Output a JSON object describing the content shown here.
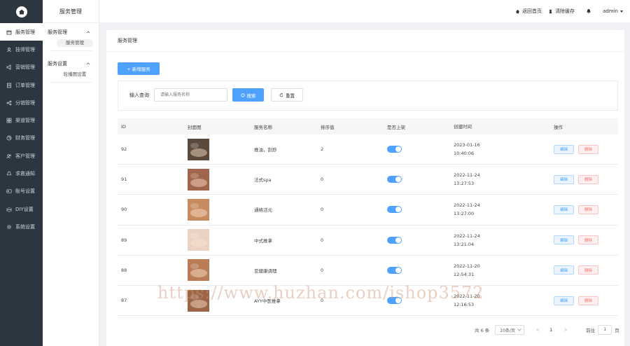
{
  "sidebar": {
    "items": [
      {
        "label": "服务管理",
        "icon": "calendar-icon",
        "active": true
      },
      {
        "label": "技师管理",
        "icon": "user-icon"
      },
      {
        "label": "营销管理",
        "icon": "megaphone-icon"
      },
      {
        "label": "订单管理",
        "icon": "clipboard-icon"
      },
      {
        "label": "分销管理",
        "icon": "share-icon"
      },
      {
        "label": "渠道管理",
        "icon": "grid-icon"
      },
      {
        "label": "财务管理",
        "icon": "pie-chart-icon"
      },
      {
        "label": "客户管理",
        "icon": "user-group-icon"
      },
      {
        "label": "求救通知",
        "icon": "bell-icon"
      },
      {
        "label": "账号设置",
        "icon": "id-card-icon"
      },
      {
        "label": "DIY设置",
        "icon": "diy-icon"
      },
      {
        "label": "系统设置",
        "icon": "gear-icon"
      }
    ]
  },
  "submenu": {
    "title": "服务管理",
    "groups": [
      {
        "label": "服务管理",
        "items": [
          "服务管理"
        ]
      },
      {
        "label": "服务设置",
        "items": [
          "轮播图设置"
        ]
      }
    ]
  },
  "topbar": {
    "home_label": "返回首页",
    "clear_cache_label": "清除缓存",
    "user_label": "admin"
  },
  "main": {
    "breadcrumb": "服务管理",
    "add_button": "+ 新增服务",
    "search": {
      "label": "输入查询",
      "placeholder": "请输入服务名称",
      "search_button": "搜索",
      "reset_button": "重置"
    },
    "table": {
      "headers": [
        "ID",
        "封面图",
        "服务名称",
        "排序值",
        "是否上架",
        "创建时间",
        "操作"
      ],
      "rows": [
        {
          "id": "92",
          "name": "推油，刮痧",
          "sort": "2",
          "on_shelf": true,
          "date": "2023-01-16",
          "time": "10:40:06",
          "cover_color": "#5b4a3c"
        },
        {
          "id": "91",
          "name": "法式spa",
          "sort": "0",
          "on_shelf": true,
          "date": "2022-11-24",
          "time": "13:27:53",
          "cover_color": "#a0654a"
        },
        {
          "id": "90",
          "name": "通络活元",
          "sort": "0",
          "on_shelf": true,
          "date": "2022-11-24",
          "time": "13:27:00",
          "cover_color": "#c68c60"
        },
        {
          "id": "89",
          "name": "中式推拿",
          "sort": "0",
          "on_shelf": true,
          "date": "2022-11-24",
          "time": "13:21:04",
          "cover_color": "#e9d2c2"
        },
        {
          "id": "88",
          "name": "亚健康调理",
          "sort": "0",
          "on_shelf": true,
          "date": "2022-11-20",
          "time": "12:54:31",
          "cover_color": "#b97c55"
        },
        {
          "id": "87",
          "name": "AYY中医推拿",
          "sort": "0",
          "on_shelf": true,
          "date": "2022-11-20",
          "time": "12:16:53",
          "cover_color": "#9c6546"
        }
      ],
      "edit_label": "编辑",
      "delete_label": "删除"
    },
    "pagination": {
      "total": "共 6 条",
      "page_size": "10条/页",
      "prev": "<",
      "current": "1",
      "next": ">",
      "goto_label": "前往",
      "goto_value": "1",
      "page_suffix": "页"
    }
  },
  "watermark": "https://www.huzhan.com/ishop3572",
  "colors": {
    "primary": "#4ea1ff",
    "sidebar_bg": "#2b3641",
    "danger": "#f56c6c"
  }
}
